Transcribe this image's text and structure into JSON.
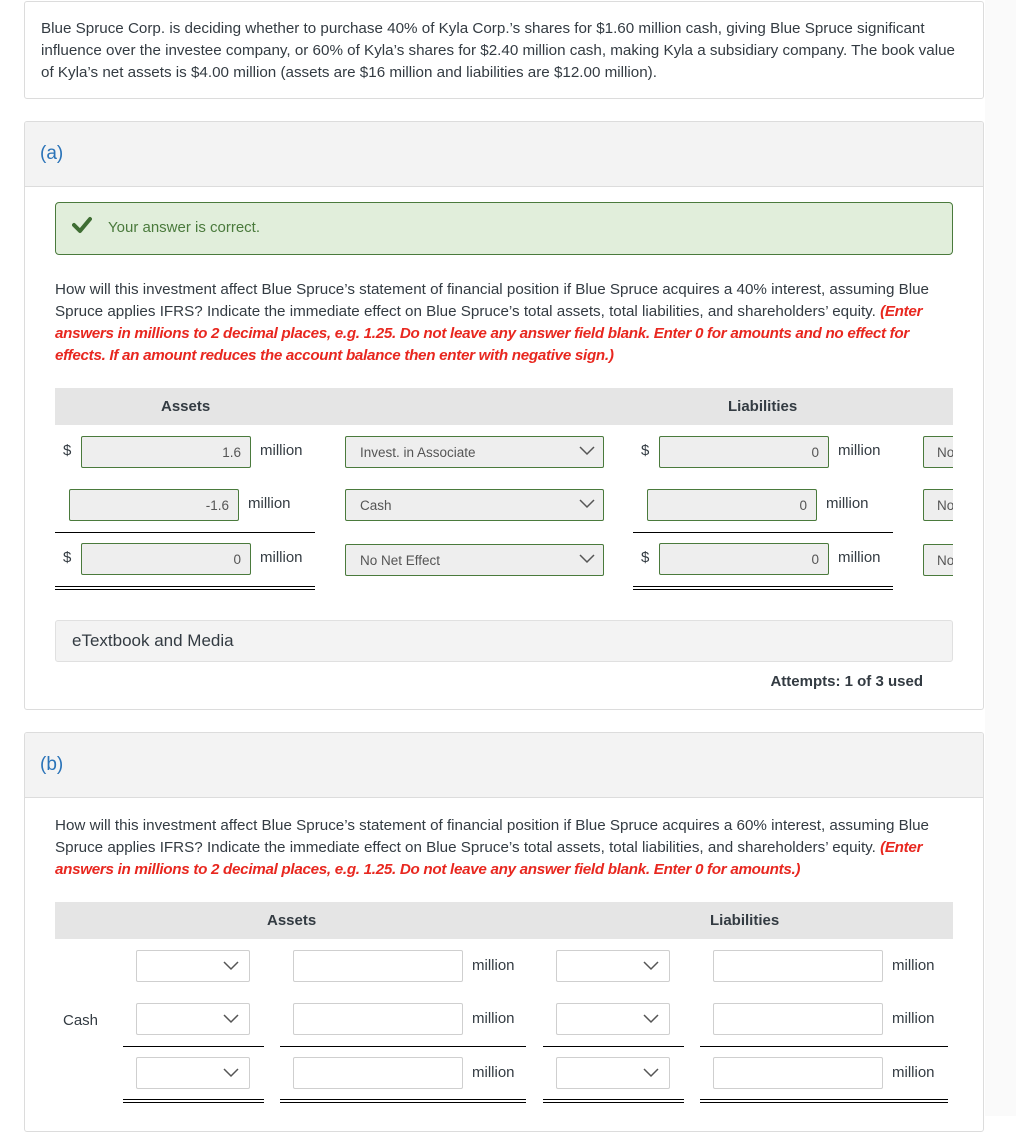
{
  "problem": {
    "text": "Blue Spruce Corp. is deciding whether to purchase 40% of Kyla Corp.’s shares for $1.60 million cash, giving Blue Spruce significant influence over the investee company, or 60% of Kyla’s shares for $2.40 million cash, making Kyla a subsidiary company. The book value of Kyla’s net assets is $4.00 million (assets are $16 million and liabilities are $12.00 million)."
  },
  "part_a": {
    "label": "(a)",
    "feedback": {
      "icon": "checkmark-icon",
      "message": "Your answer is correct.",
      "color": "#4a7a3c"
    },
    "question": "How will this investment affect Blue Spruce’s statement of financial position if Blue Spruce acquires a 40% interest, assuming Blue Spruce applies IFRS? Indicate the immediate effect on Blue Spruce’s total assets, total liabilities, and shareholders’ equity.",
    "instruction": "(Enter answers in millions to 2 decimal places, e.g. 1.25. Do not leave any answer field blank. Enter 0 for amounts and no effect for effects. If an amount reduces the account balance then enter with negative sign.)",
    "table": {
      "headers": {
        "assets": "Assets",
        "liabilities": "Liabilities"
      },
      "currency": "$",
      "unit": "million",
      "rows": [
        {
          "asset_amount": "1.6",
          "account": "Invest. in Associate",
          "liability_amount": "0",
          "effect": "No"
        },
        {
          "asset_amount": "-1.6",
          "account": "Cash",
          "liability_amount": "0",
          "effect": "No"
        },
        {
          "asset_amount": "0",
          "account": "No Net Effect",
          "liability_amount": "0",
          "effect": "No"
        }
      ]
    },
    "etextbook_label": "eTextbook and Media",
    "attempts": "Attempts: 1 of 3 used"
  },
  "part_b": {
    "label": "(b)",
    "question": "How will this investment affect Blue Spruce’s statement of financial position if Blue Spruce acquires a 60% interest, assuming Blue Spruce applies IFRS? Indicate the immediate effect on Blue Spruce’s total assets, total liabilities, and shareholders’ equity.",
    "instruction": "(Enter answers in millions to 2 decimal places, e.g. 1.25. Do not leave any answer field blank. Enter 0 for amounts.)",
    "table": {
      "headers": {
        "assets": "Assets",
        "liabilities": "Liabilities"
      },
      "unit": "million",
      "rows": [
        {
          "label": "",
          "asset_select": "",
          "asset_amount": "",
          "liability_select": "",
          "liability_amount": ""
        },
        {
          "label": "Cash",
          "asset_select": "",
          "asset_amount": "",
          "liability_select": "",
          "liability_amount": ""
        },
        {
          "label": "",
          "asset_select": "",
          "asset_amount": "",
          "liability_select": "",
          "liability_amount": ""
        }
      ]
    }
  }
}
